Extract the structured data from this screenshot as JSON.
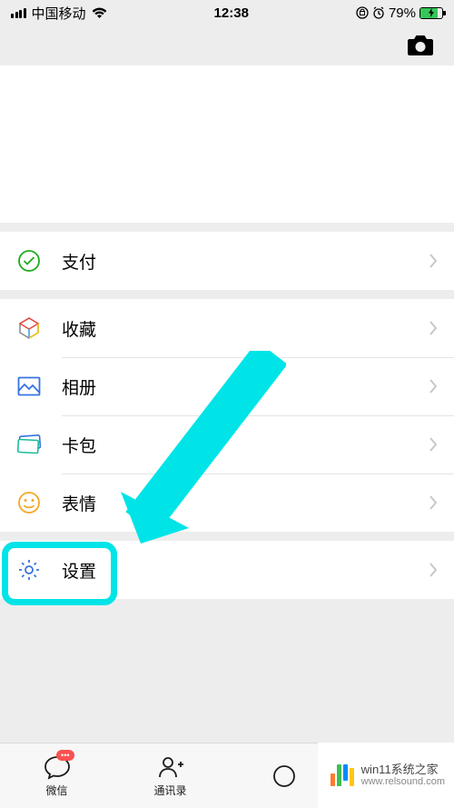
{
  "status": {
    "carrier": "中国移动",
    "time": "12:38",
    "battery_pct": "79%"
  },
  "menu": {
    "pay": "支付",
    "favorites": "收藏",
    "album": "相册",
    "cards": "卡包",
    "sticker": "表情",
    "settings": "设置"
  },
  "tabs": {
    "chats": "微信",
    "contacts": "通讯录",
    "badge": "•••"
  },
  "watermark": {
    "line1": "win11系统之家",
    "line2": "www.relsound.com"
  }
}
